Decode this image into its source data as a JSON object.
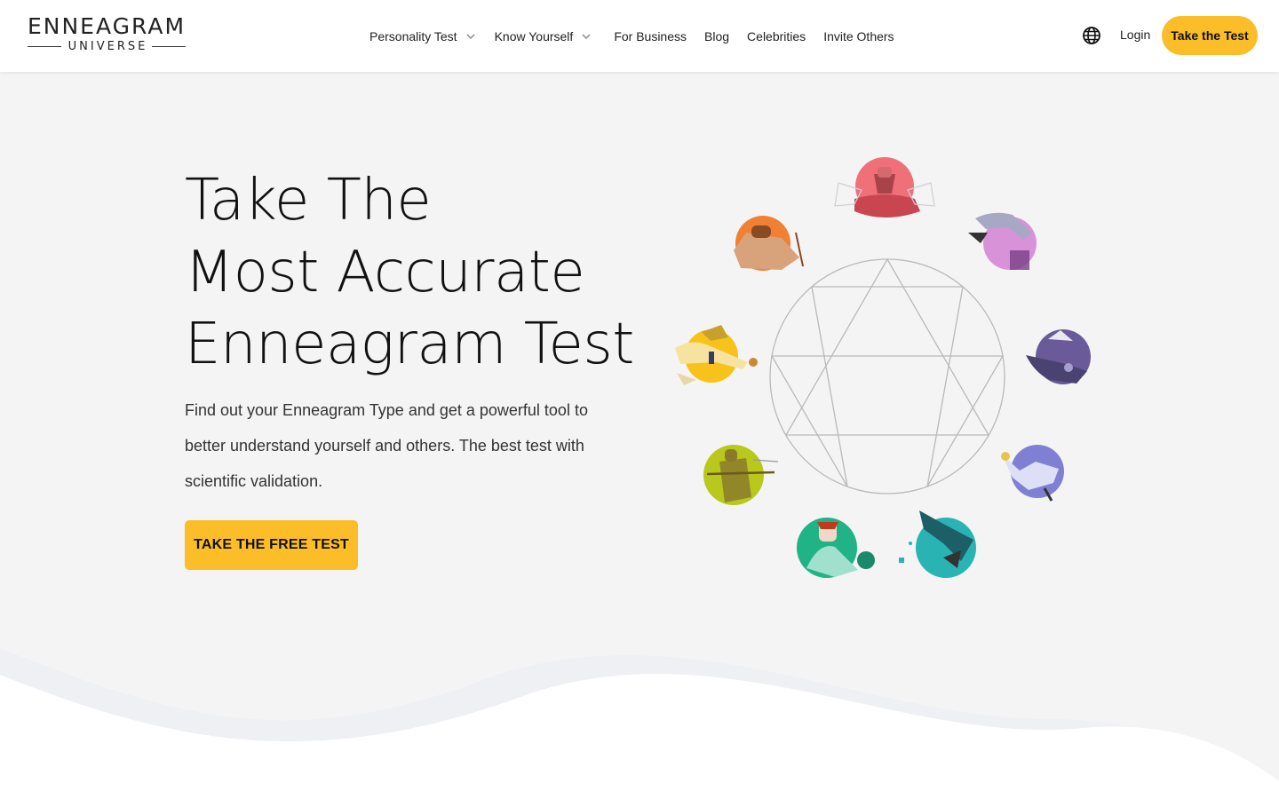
{
  "brand": {
    "name": "ENNEAGRAM",
    "sub": "UNIVERSE"
  },
  "nav": {
    "items": [
      {
        "label": "Personality Test",
        "dropdown": true
      },
      {
        "label": "Know Yourself",
        "dropdown": true
      },
      {
        "label": "For Business",
        "dropdown": false
      },
      {
        "label": "Blog",
        "dropdown": false
      },
      {
        "label": "Celebrities",
        "dropdown": false
      },
      {
        "label": "Invite Others",
        "dropdown": false
      }
    ]
  },
  "header": {
    "language_icon": "globe-icon",
    "login_label": "Login",
    "cta_label": "Take the Test"
  },
  "hero": {
    "title_lines": [
      "Take The",
      "Most Accurate",
      "Enneagram Test"
    ],
    "description": "Find out your Enneagram Type and get a powerful tool to better understand yourself and others. The best test with scientific validation.",
    "cta_label": "TAKE THE FREE TEST"
  },
  "colors": {
    "accent": "#fbbd28",
    "background": "#f4f4f4",
    "type_circles": [
      "#f0707a",
      "#d893d8",
      "#6a5a9a",
      "#7f7fd4",
      "#2ab3b3",
      "#1fb386",
      "#b8c81c",
      "#f7c21a",
      "#f08033"
    ]
  }
}
